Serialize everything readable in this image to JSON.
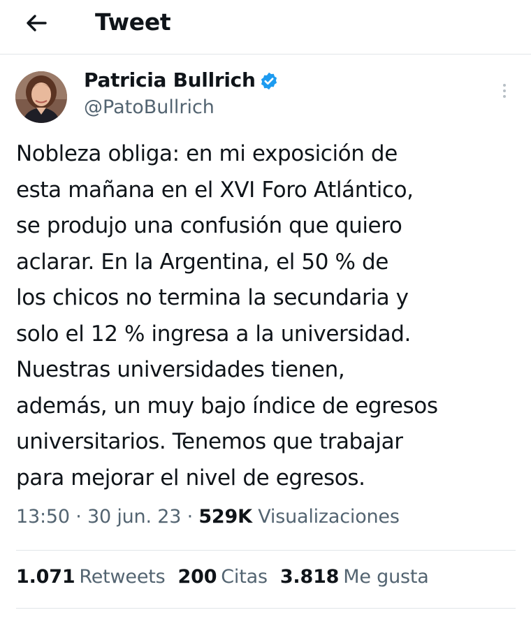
{
  "header": {
    "title": "Tweet",
    "back_icon": "arrow-left-icon"
  },
  "author": {
    "display_name": "Patricia Bullrich",
    "handle": "@PatoBullrich",
    "verified": true,
    "verified_color": "#1d9bf0"
  },
  "tweet": {
    "text": "Nobleza obliga: en mi exposición de\nesta mañana en el XVI Foro Atlántico,\nse produjo una confusión que quiero\naclarar. En la Argentina, el 50 % de\nlos chicos no termina la secundaria y\nsolo el 12 % ingresa a la universidad.\nNuestras universidades tienen,\nademás, un muy bajo índice de egresos\nuniversitarios. Tenemos que trabajar\npara mejorar el nivel de egresos.",
    "time": "13:50",
    "date": "30 jun. 23",
    "separator": "·",
    "views_count": "529K",
    "views_label": "Visualizaciones"
  },
  "stats": {
    "retweets_count": "1.071",
    "retweets_label": "Retweets",
    "quotes_count": "200",
    "quotes_label": "Citas",
    "likes_count": "3.818",
    "likes_label": "Me gusta"
  }
}
